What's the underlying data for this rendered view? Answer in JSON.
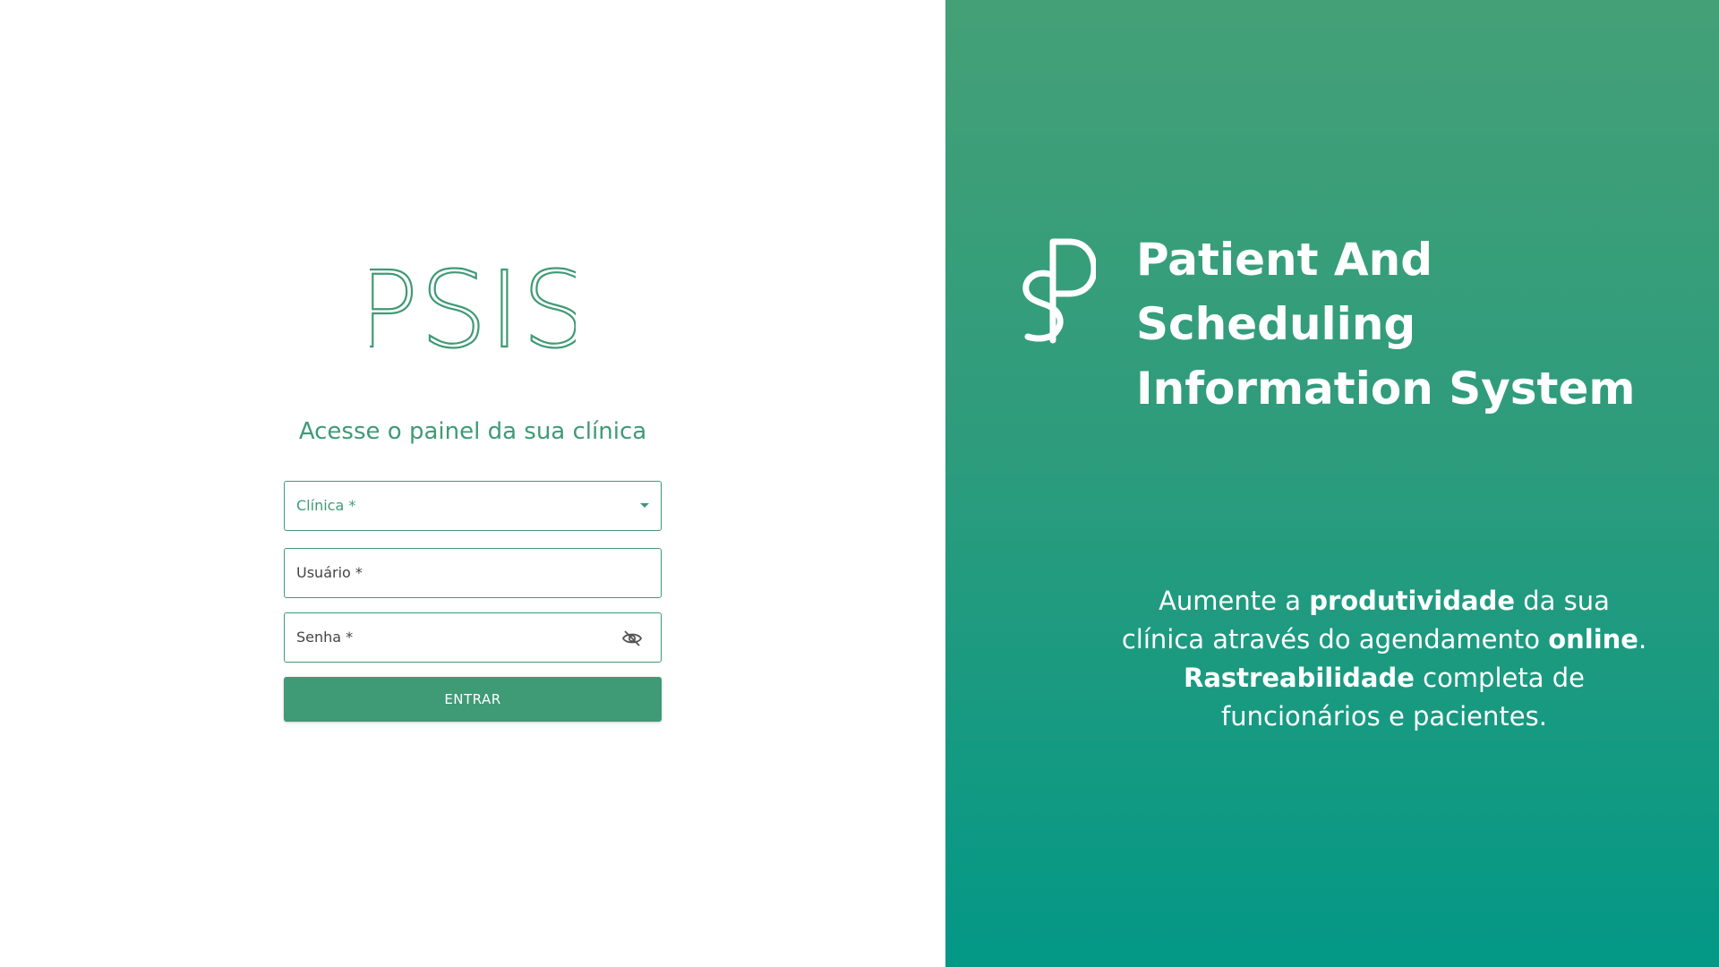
{
  "login": {
    "logo_text": "PSIS",
    "subtitle": "Acesse o painel da sua clínica",
    "clinica_label": "Clínica *",
    "usuario_label": "Usuário *",
    "senha_label": "Senha *",
    "submit_label": "ENTRAR"
  },
  "brand": {
    "title_line1": "Patient And Scheduling",
    "title_line2": "Information System",
    "logo_icon": "ps-monogram-icon"
  },
  "tagline": {
    "l1_a": "Aumente a ",
    "l1_b": "produtividade",
    "l1_c": " da sua",
    "l2_a": "clínica através do agendamento ",
    "l2_b": "online",
    "l2_c": ".",
    "l3_a": "Rastreabilidade",
    "l3_b": " completa de",
    "l4": "funcionários e pacientes."
  },
  "colors": {
    "accent": "#3f9a76",
    "gradient_top": "#44a077",
    "gradient_bottom": "#039886"
  }
}
